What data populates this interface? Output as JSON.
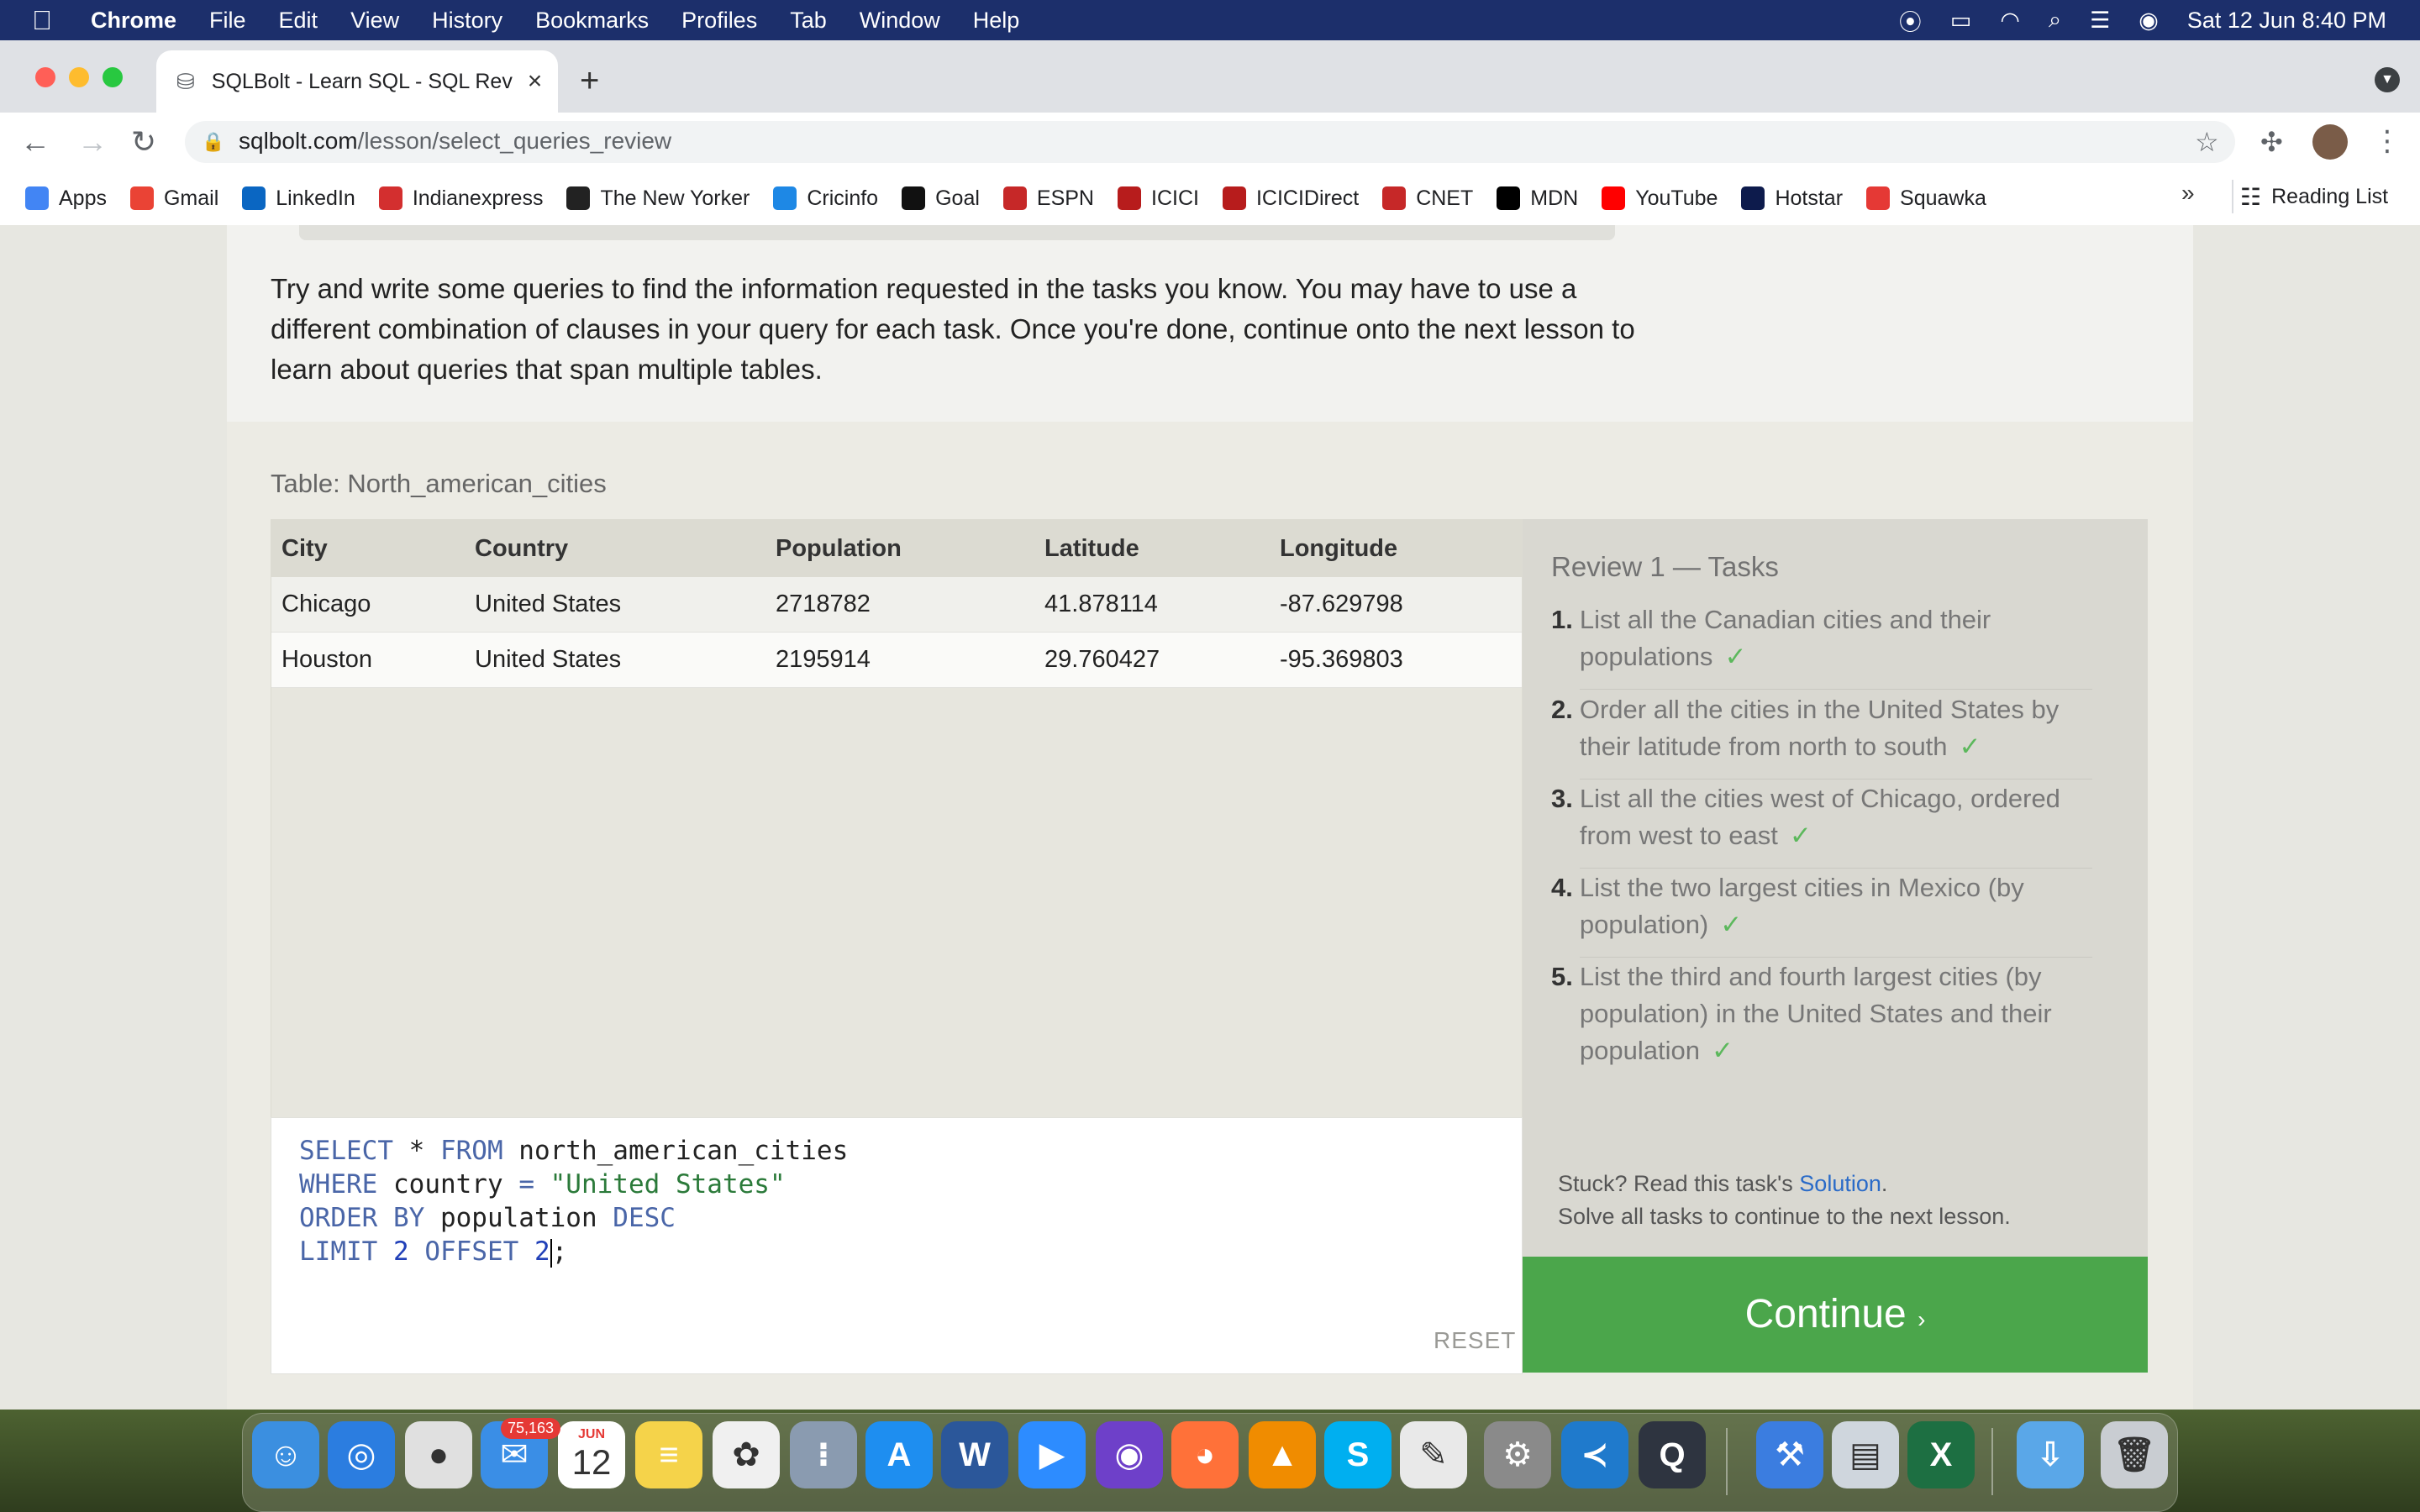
{
  "menubar": {
    "apple": "",
    "app": "Chrome",
    "items": [
      "File",
      "Edit",
      "View",
      "History",
      "Bookmarks",
      "Profiles",
      "Tab",
      "Window",
      "Help"
    ],
    "datetime": "Sat 12 Jun  8:40 PM"
  },
  "tab": {
    "title": "SQLBolt - Learn SQL - SQL Rev",
    "close": "×",
    "new": "+"
  },
  "url": {
    "host": "sqlbolt.com",
    "path": "/lesson/select_queries_review"
  },
  "bookmarks": [
    {
      "label": "Apps",
      "color": "#4285f4"
    },
    {
      "label": "Gmail",
      "color": "#ea4335"
    },
    {
      "label": "LinkedIn",
      "color": "#0a66c2"
    },
    {
      "label": "Indianexpress",
      "color": "#d32f2f"
    },
    {
      "label": "The New Yorker",
      "color": "#222222"
    },
    {
      "label": "Cricinfo",
      "color": "#1e88e5"
    },
    {
      "label": "Goal",
      "color": "#111111"
    },
    {
      "label": "ESPN",
      "color": "#c62828"
    },
    {
      "label": "ICICI",
      "color": "#b71c1c"
    },
    {
      "label": "ICICIDirect",
      "color": "#b71c1c"
    },
    {
      "label": "CNET",
      "color": "#c62828"
    },
    {
      "label": "MDN",
      "color": "#000000"
    },
    {
      "label": "YouTube",
      "color": "#ff0000"
    },
    {
      "label": "Hotstar",
      "color": "#0d1b4c"
    },
    {
      "label": "Squawka",
      "color": "#e53935"
    }
  ],
  "bookmarks_more": "»",
  "reading_list": "Reading List",
  "page": {
    "intro": "Try and write some queries to find the information requested in the tasks you know. You may have to use a different combination of clauses in your query for each task. Once you're done, continue onto the next lesson to learn about queries that span multiple tables.",
    "table_title": "Table: North_american_cities",
    "columns": [
      "City",
      "Country",
      "Population",
      "Latitude",
      "Longitude"
    ],
    "rows": [
      [
        "Chicago",
        "United States",
        "2718782",
        "41.878114",
        "-87.629798"
      ],
      [
        "Houston",
        "United States",
        "2195914",
        "29.760427",
        "-95.369803"
      ]
    ],
    "code": {
      "l1": [
        "SELECT",
        " * ",
        "FROM",
        " north_american_cities"
      ],
      "l2": [
        "WHERE",
        " country ",
        "=",
        " \"United States\""
      ],
      "l3": [
        "ORDER BY",
        " population ",
        "DESC"
      ],
      "l4": [
        "LIMIT",
        " 2 ",
        "OFFSET",
        " 2",
        ";"
      ]
    },
    "reset": "RESET",
    "tasks_title": "Review 1 — Tasks",
    "tasks": [
      {
        "n": "1.",
        "text": "List all the Canadian cities and their populations",
        "check": "✓"
      },
      {
        "n": "2.",
        "text": "Order all the cities in the United States by their latitude from north to south",
        "check": "✓"
      },
      {
        "n": "3.",
        "text": "List all the cities west of Chicago, ordered from west to east",
        "check": "✓"
      },
      {
        "n": "4.",
        "text": "List the two largest cities in Mexico (by population)",
        "check": "✓"
      },
      {
        "n": "5.",
        "text": "List the third and fourth largest cities (by population) in the United States and their population",
        "check": "✓"
      }
    ],
    "stuck_pre": "Stuck? Read this task's ",
    "stuck_link": "Solution",
    "stuck_post": ".",
    "stuck_line2": "Solve all tasks to continue to the next lesson.",
    "continue": "Continue",
    "continue_arrow": "›"
  },
  "dock": {
    "mail_badge": "75,163",
    "cal_month": "JUN",
    "cal_day": "12",
    "apps": [
      {
        "name": "finder",
        "color": "#3b8fe0",
        "glyph": "☺"
      },
      {
        "name": "safari",
        "color": "#2b7de0",
        "glyph": "◎"
      },
      {
        "name": "chrome",
        "color": "#e0e0e0",
        "glyph": "●"
      },
      {
        "name": "mail",
        "color": "#3a8ee6",
        "glyph": "✉"
      },
      {
        "name": "calendar",
        "color": "#ffffff",
        "glyph": ""
      },
      {
        "name": "notes",
        "color": "#f5d34a",
        "glyph": "≡"
      },
      {
        "name": "photos",
        "color": "#f0f0f0",
        "glyph": "✿"
      },
      {
        "name": "launchpad",
        "color": "#8a9bb0",
        "glyph": "⁝"
      },
      {
        "name": "app-store",
        "color": "#1e8ef0",
        "glyph": "A"
      },
      {
        "name": "word",
        "color": "#2b579a",
        "glyph": "W"
      },
      {
        "name": "zoom",
        "color": "#2d8cff",
        "glyph": "▶"
      },
      {
        "name": "github",
        "color": "#6e40c9",
        "glyph": "◉"
      },
      {
        "name": "firefox",
        "color": "#ff7139",
        "glyph": "◕"
      },
      {
        "name": "vlc",
        "color": "#f08c00",
        "glyph": "▲"
      },
      {
        "name": "skype",
        "color": "#00aff0",
        "glyph": "S"
      },
      {
        "name": "textedit",
        "color": "#e9e9e9",
        "glyph": "✎"
      },
      {
        "name": "system-preferences",
        "color": "#8a8a8a",
        "glyph": "⚙"
      },
      {
        "name": "vscode",
        "color": "#1f7acc",
        "glyph": "≺"
      },
      {
        "name": "quicktime",
        "color": "#2e3440",
        "glyph": "Q"
      },
      {
        "name": "xcode",
        "color": "#3b7de0",
        "glyph": "⚒"
      },
      {
        "name": "preview",
        "color": "#cfd6dd",
        "glyph": "▤"
      },
      {
        "name": "excel",
        "color": "#1d6f42",
        "glyph": "X"
      },
      {
        "name": "downloads",
        "color": "#5aa7e8",
        "glyph": "⇩"
      },
      {
        "name": "trash",
        "color": "#c9cdd2",
        "glyph": "🗑"
      }
    ]
  }
}
